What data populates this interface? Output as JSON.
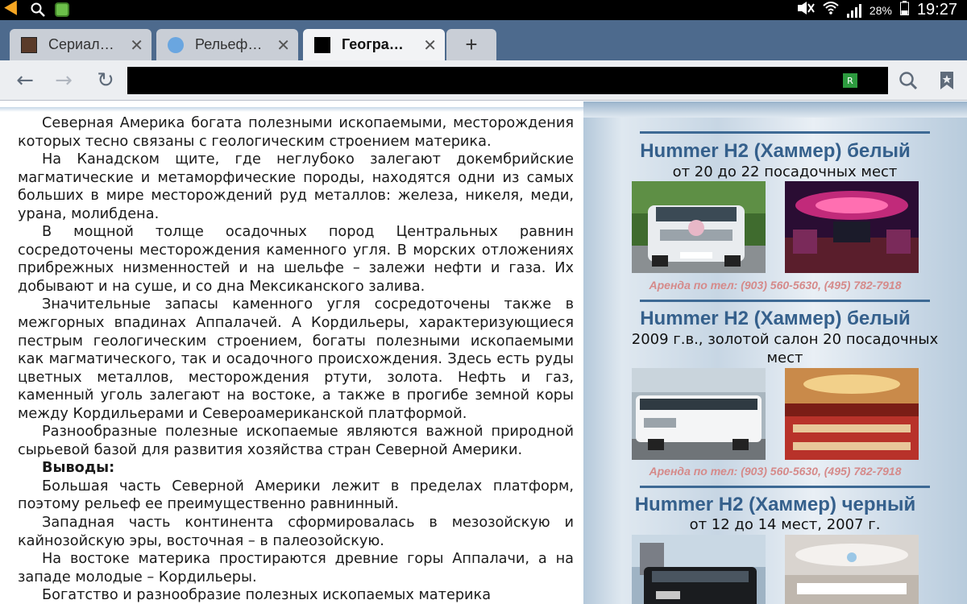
{
  "status_bar": {
    "battery": "28%",
    "time": "19:27",
    "icons": [
      "pizza-icon",
      "search-icon",
      "game-icon",
      "mute-icon",
      "wifi-icon",
      "signal-icon",
      "battery-icon"
    ]
  },
  "tabs": [
    {
      "title": "Сериал…",
      "favicon": "tv-series-favicon",
      "active": false
    },
    {
      "title": "Рельеф…",
      "favicon": "relief-favicon",
      "active": false
    },
    {
      "title": "Геогра…",
      "favicon": "geography-favicon",
      "active": true
    }
  ],
  "new_tab_label": "+",
  "toolbar": {
    "back_icon": "←",
    "forward_icon": "→",
    "reload_icon": "↻",
    "url": "",
    "search_icon": "search-icon",
    "bookmark_icon": "bookmark-icon"
  },
  "article": {
    "paragraphs": [
      "Северная Америка богата полезными ископаемыми, месторождения которых тесно связаны с геологическим строением материка.",
      "На Канадском щите, где неглубоко залегают докембрийские магматические и метаморфические породы, находятся одни из самых больших в мире месторождений руд металлов: железа, никеля, меди, урана, молибдена.",
      "В мощной толще осадочных пород Центральных равнин сосредоточены месторождения каменного угля. В морских отложениях прибрежных низменностей и на шельфе – залежи нефти и газа. Их добывают и на суше, и со дна Мексиканского залива.",
      "Значительные запасы каменного угля сосредоточены также в межгорных впадинах Аппалачей. А Кордильеры, характеризующиеся пестрым геологическим строением, богаты полезными ископаемыми как магматического, так и осадочного происхождения. Здесь есть руды цветных металлов, месторождения ртути, золота. Нефть и газ, каменный уголь залегают на востоке, а также в прогибе земной коры между Кордильерами и Североамериканской платформой.",
      "Разнообразные полезные ископаемые являются важной природной сырьевой базой для развития хозяйства стран Северной Америки."
    ],
    "conclusions_heading": "Выводы:",
    "conclusions": [
      "Большая часть Северной Америки лежит в пределах платформ, поэтому рельеф ее преимущественно равнинный.",
      "Западная часть континента сформировалась в мезозойскую и кайнозойскую эры, восточная – в палеозойскую.",
      "На востоке материка простираются древние горы Аппалачи, а на западе молодые – Кордильеры.",
      "Богатство и разнообразие полезных ископаемых материка"
    ]
  },
  "ads": [
    {
      "title": "Hummer H2 (Хаммер) белый",
      "subtitle": "от 20 до 22 посадочных мест",
      "phone": "Аренда по тел: (903) 560-5630, (495) 782-7918",
      "photo_left": "white-hummer-wedding-photo",
      "photo_right": "purple-limo-interior-photo"
    },
    {
      "title": "Hummer H2 (Хаммер) белый",
      "subtitle": "2009 г.в., золотой салон 20 посадочных мест",
      "phone": "Аренда по тел: (903) 560-5630, (495) 782-7918",
      "photo_left": "white-stretch-hummer-photo",
      "photo_right": "gold-limo-interior-photo"
    },
    {
      "title": "Hummer H2 (Хаммер) черный",
      "subtitle": "от 12 до 14 мест, 2007 г.",
      "photo_left": "black-hummer-photo",
      "photo_right": "white-limo-interior-photo"
    }
  ]
}
